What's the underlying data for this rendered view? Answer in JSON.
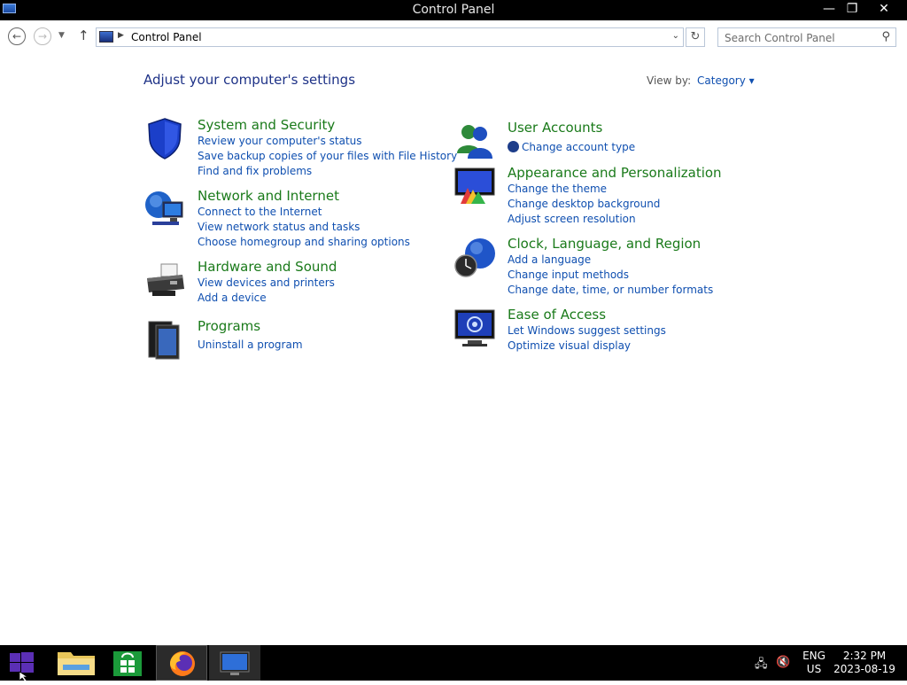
{
  "window": {
    "title": "Control Panel"
  },
  "address": {
    "breadcrumb": "Control Panel"
  },
  "search": {
    "placeholder": "Search Control Panel"
  },
  "main": {
    "heading": "Adjust your computer's settings",
    "view_by_label": "View by:",
    "view_by_value": "Category",
    "left_categories": [
      {
        "title": "System and Security",
        "links": [
          "Review your computer's status",
          "Save backup copies of your files with File History",
          "Find and fix problems"
        ]
      },
      {
        "title": "Network and Internet",
        "links": [
          "Connect to the Internet",
          "View network status and tasks",
          "Choose homegroup and sharing options"
        ]
      },
      {
        "title": "Hardware and Sound",
        "links": [
          "View devices and printers",
          "Add a device"
        ]
      },
      {
        "title": "Programs",
        "links": [
          "Uninstall a program"
        ]
      }
    ],
    "right_categories": [
      {
        "title": "User Accounts",
        "links": [
          "Change account type"
        ]
      },
      {
        "title": "Appearance and Personalization",
        "links": [
          "Change the theme",
          "Change desktop background",
          "Adjust screen resolution"
        ]
      },
      {
        "title": "Clock, Language, and Region",
        "links": [
          "Add a language",
          "Change input methods",
          "Change date, time, or number formats"
        ]
      },
      {
        "title": "Ease of Access",
        "links": [
          "Let Windows suggest settings",
          "Optimize visual display"
        ]
      }
    ]
  },
  "taskbar": {
    "language_top": "ENG",
    "language_bottom": "US",
    "time": "2:32 PM",
    "date": "2023-08-19",
    "items": [
      "start-icon",
      "file-explorer-icon",
      "store-icon",
      "firefox-icon",
      "control-panel-icon"
    ]
  },
  "colors": {
    "link": "#0f4fb0",
    "category_title": "#1a7a1a",
    "heading": "#1e3287",
    "taskbar": "#000000"
  }
}
